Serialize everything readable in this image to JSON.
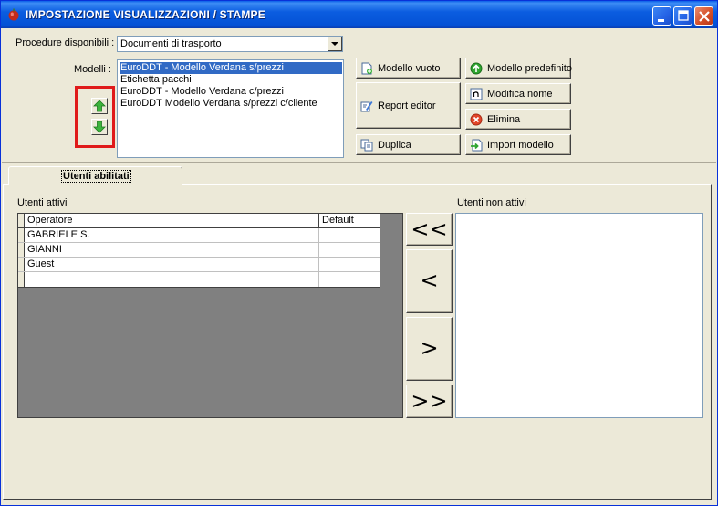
{
  "window": {
    "title": "IMPOSTAZIONE VISUALIZZAZIONI / STAMPE",
    "controls": [
      "minimize",
      "maximize",
      "close"
    ]
  },
  "procedure": {
    "label": "Procedure disponibili :",
    "selected": "Documenti di trasporto"
  },
  "models": {
    "label": "Modelli :",
    "items": [
      "EuroDDT - Modello Verdana s/prezzi",
      "Etichetta pacchi",
      "EuroDDT - Modello Verdana c/prezzi",
      "EuroDDT Modello Verdana s/prezzi c/cliente"
    ],
    "selected_index": 0
  },
  "buttons": {
    "modello_vuoto": "Modello vuoto",
    "report_editor": "Report editor",
    "duplica": "Duplica",
    "modello_predefinito": "Modello predefinito",
    "modifica_nome": "Modifica nome",
    "elimina": "Elimina",
    "import_modello": "Import modello"
  },
  "tab": {
    "label": "Utenti abilitati"
  },
  "active_users": {
    "label": "Utenti attivi",
    "columns": [
      "Operatore",
      "Default"
    ],
    "rows": [
      [
        "GABRIELE S.",
        ""
      ],
      [
        "GIANNI",
        ""
      ],
      [
        "Guest",
        ""
      ],
      [
        "",
        ""
      ]
    ]
  },
  "move_buttons": {
    "add_all": "<<",
    "add": "<",
    "remove": ">",
    "remove_all": ">>"
  },
  "inactive_users": {
    "label": "Utenti non attivi",
    "items": []
  },
  "colors": {
    "titlebar": "#0452D6",
    "selection": "#316AC5",
    "highlight_box": "#E01B1B",
    "window_bg": "#ECE9D8",
    "grid_bg": "#808080"
  }
}
